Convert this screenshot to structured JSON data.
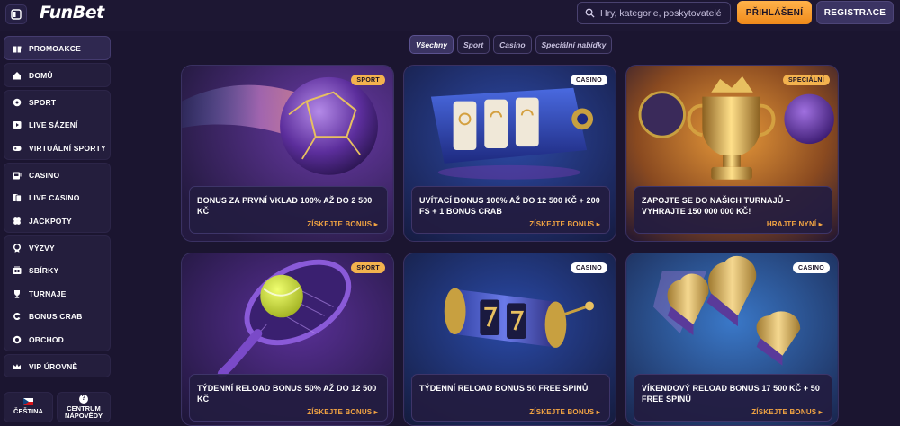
{
  "header": {
    "logo": "FunBet",
    "search_placeholder": "Hry, kategorie, poskytovatelé",
    "login_label": "PŘIHLÁŠENÍ",
    "register_label": "REGISTRACE"
  },
  "sidebar": {
    "promo": {
      "label": "PROMOAKCE",
      "icon": "gift-icon"
    },
    "home": {
      "label": "DOMŮ",
      "icon": "home-icon"
    },
    "sports": [
      {
        "label": "SPORT",
        "icon": "soccer-ball-icon"
      },
      {
        "label": "LIVE SÁZENÍ",
        "icon": "live-play-icon"
      },
      {
        "label": "VIRTUÁLNÍ SPORTY",
        "icon": "gamepad-icon"
      }
    ],
    "casino": [
      {
        "label": "CASINO",
        "icon": "slot-machine-icon"
      },
      {
        "label": "LIVE CASINO",
        "icon": "cards-icon"
      },
      {
        "label": "JACKPOTY",
        "icon": "clover-icon"
      }
    ],
    "extras": [
      {
        "label": "VÝZVY",
        "icon": "medal-icon"
      },
      {
        "label": "SBÍRKY",
        "icon": "collection-icon"
      },
      {
        "label": "TURNAJE",
        "icon": "trophy-icon"
      },
      {
        "label": "BONUS CRAB",
        "icon": "crab-icon"
      },
      {
        "label": "OBCHOD",
        "icon": "shop-icon"
      }
    ],
    "vip": {
      "label": "VIP ÚROVNĚ",
      "icon": "crown-icon"
    },
    "language": {
      "label": "ČEŠTINA",
      "icon": "czech-flag-icon"
    },
    "help": {
      "line1": "CENTRUM",
      "line2": "NÁPOVĚDY",
      "icon": "help-icon"
    }
  },
  "filters": [
    {
      "label": "Všechny",
      "active": true
    },
    {
      "label": "Sport",
      "active": false
    },
    {
      "label": "Casino",
      "active": false
    },
    {
      "label": "Speciální nabídky",
      "active": false
    }
  ],
  "cards": [
    {
      "badge": "SPORT",
      "title": "BONUS ZA PRVNÍ VKLAD 100% AŽ DO 2 500 KČ",
      "cta": "ZÍSKEJTE BONUS",
      "art": "soccer-ball-art"
    },
    {
      "badge": "CASINO",
      "title": "UVÍTACÍ BONUS 100% AŽ DO 12 500 KČ + 200 FS + 1 BONUS CRAB",
      "cta": "ZÍSKEJTE BONUS",
      "art": "slot-reels-art"
    },
    {
      "badge": "SPECIÁLNÍ",
      "title": "ZAPOJTE SE DO NAŠICH TURNAJŮ – VYHRAJTE 150 000 000 KČ!",
      "cta": "HRAJTE NYNÍ",
      "art": "trophy-art"
    },
    {
      "badge": "SPORT",
      "title": "TÝDENNÍ RELOAD BONUS 50% AŽ DO 12 500 KČ",
      "cta": "ZÍSKEJTE BONUS",
      "art": "tennis-racket-art"
    },
    {
      "badge": "CASINO",
      "title": "TÝDENNÍ RELOAD BONUS 50 FREE SPINŮ",
      "cta": "ZÍSKEJTE BONUS",
      "art": "slot-drum-art"
    },
    {
      "badge": "CASINO",
      "title": "VÍKENDOVÝ RELOAD BONUS 17 500 KČ + 50 FREE SPINŮ",
      "cta": "ZÍSKEJTE BONUS",
      "art": "hearts-art"
    }
  ],
  "colors": {
    "background": "#1b1530",
    "accent_orange": "#f2a443",
    "panel": "#241e3d"
  }
}
